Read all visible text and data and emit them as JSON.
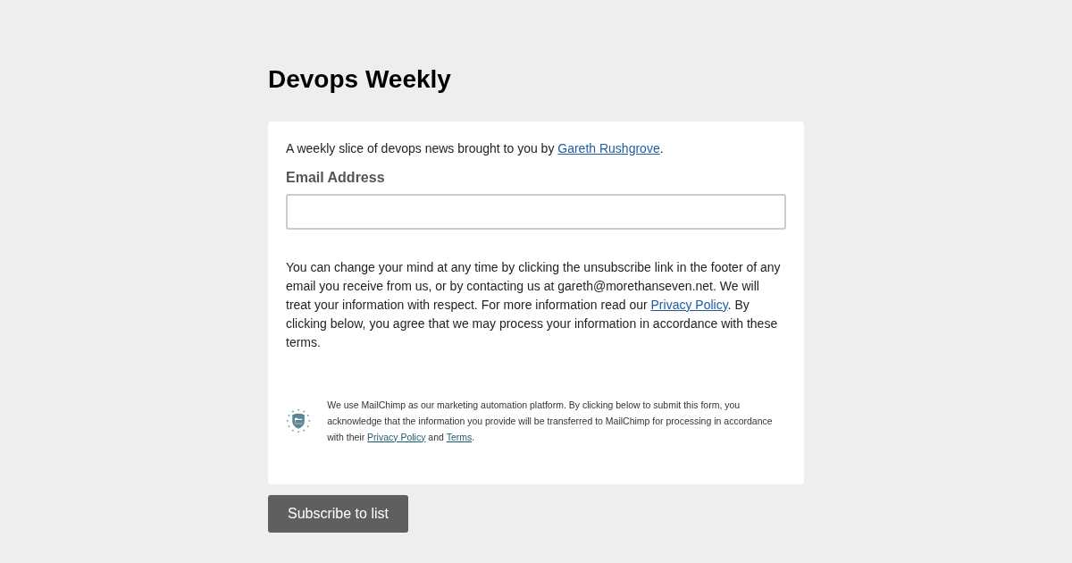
{
  "title": "Devops Weekly",
  "intro": [
    {
      "kind": "text",
      "text": "A weekly slice of devops news brought to you by "
    },
    {
      "kind": "link",
      "text": "Gareth Rushgrove"
    },
    {
      "kind": "text",
      "text": "."
    }
  ],
  "email_field": {
    "label": "Email Address"
  },
  "consent": [
    {
      "kind": "text",
      "text": "You can change your mind at any time by clicking the unsubscribe link in the footer of any email you receive from us, or by contacting us at gareth@morethanseven.net. We will treat your information with respect. For more information read our "
    },
    {
      "kind": "link",
      "text": "Privacy Policy"
    },
    {
      "kind": "text",
      "text": ". By clicking below, you agree that we may process your information in accordance with these terms."
    }
  ],
  "mailchimp_notice": [
    {
      "kind": "text",
      "text": "We use MailChimp as our marketing automation platform. By clicking below to submit this form, you acknowledge that the information you provide will be transferred to MailChimp for processing in accordance with their "
    },
    {
      "kind": "link",
      "text": "Privacy Policy"
    },
    {
      "kind": "text",
      "text": " and "
    },
    {
      "kind": "link",
      "text": "Terms"
    },
    {
      "kind": "text",
      "text": "."
    }
  ],
  "submit_button": "Subscribe to list"
}
